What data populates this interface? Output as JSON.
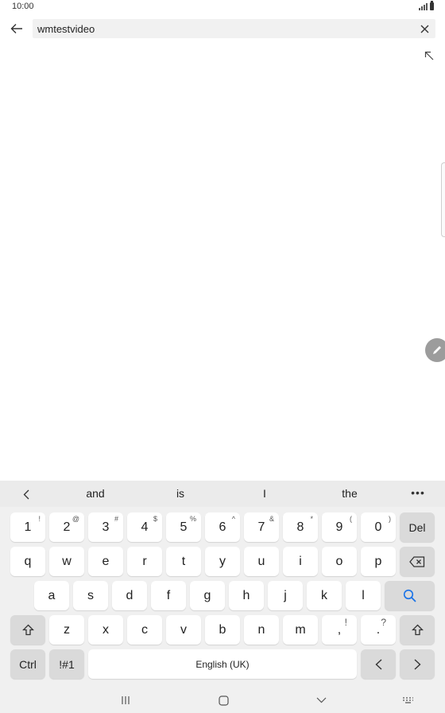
{
  "status_bar": {
    "time": "10:00"
  },
  "search": {
    "query": "wmtestvideo"
  },
  "suggestions": [
    "and",
    "is",
    "I",
    "the"
  ],
  "keyboard": {
    "row1": [
      {
        "key": "1",
        "hint": "!"
      },
      {
        "key": "2",
        "hint": "@"
      },
      {
        "key": "3",
        "hint": "#"
      },
      {
        "key": "4",
        "hint": "$"
      },
      {
        "key": "5",
        "hint": "%"
      },
      {
        "key": "6",
        "hint": "^"
      },
      {
        "key": "7",
        "hint": "&"
      },
      {
        "key": "8",
        "hint": "*"
      },
      {
        "key": "9",
        "hint": "("
      },
      {
        "key": "0",
        "hint": ")"
      }
    ],
    "del_label": "Del",
    "row2": [
      "q",
      "w",
      "e",
      "r",
      "t",
      "y",
      "u",
      "i",
      "o",
      "p"
    ],
    "row3": [
      "a",
      "s",
      "d",
      "f",
      "g",
      "h",
      "j",
      "k",
      "l"
    ],
    "row4": [
      "z",
      "x",
      "c",
      "v",
      "b",
      "n",
      "m"
    ],
    "comma": {
      "key": ",",
      "hint": "!"
    },
    "period": {
      "key": ".",
      "hint": "?"
    },
    "ctrl_label": "Ctrl",
    "symbols_label": "!#1",
    "space_label": "English (UK)"
  },
  "colors": {
    "accent": "#1a73e8",
    "keyboard_bg": "#f0f0f0",
    "func_key": "#dadada"
  }
}
